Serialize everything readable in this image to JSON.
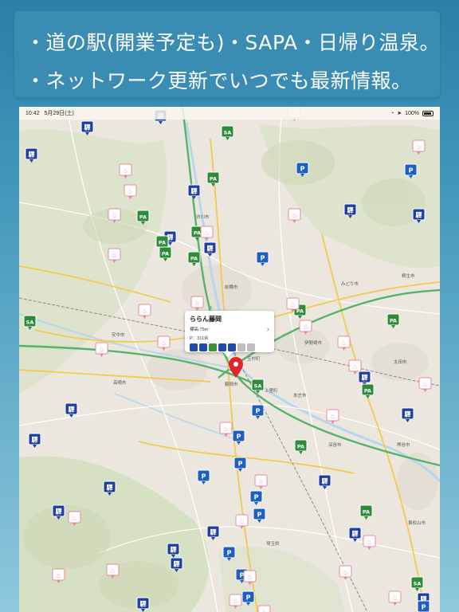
{
  "banner": {
    "line1": "・道の駅(開業予定も)・SAPA・日帰り温泉。",
    "line2": "・ネットワーク更新でいつでも最新情報。"
  },
  "status": {
    "time": "10:42",
    "date": "5月29日(土)",
    "battery": "100%"
  },
  "popup": {
    "title": "ららん藤岡",
    "elevation": "標高:75m",
    "parking": "P：311台",
    "chevron": "›"
  },
  "places": [
    "渋川市",
    "前橋市",
    "伊勢崎市",
    "太田市",
    "高崎市",
    "藤岡市",
    "本庄市",
    "深谷市",
    "熊谷市",
    "埼玉県",
    "東松山市",
    "みどり市",
    "桐生市",
    "安中市",
    "玉村町",
    "上里町"
  ],
  "colors": {
    "michi_no_eki": "#1e3ea0",
    "sapa_green": "#2e8b3a",
    "onsen_pink": "#e8879a",
    "parking_blue": "#1f5fbf",
    "highway_green": "#55b36a",
    "road_yellow": "#f3c94f",
    "river_blue": "#b9d6ec"
  }
}
